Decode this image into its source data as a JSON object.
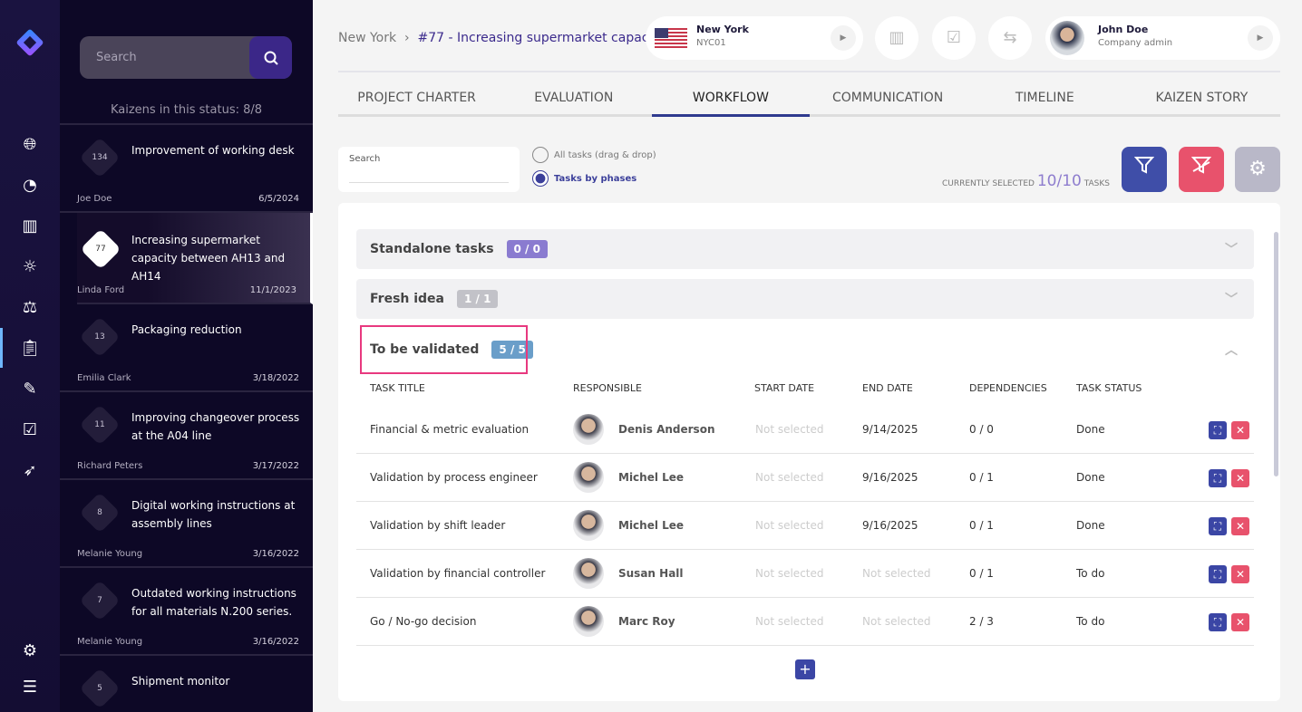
{
  "list": {
    "search_placeholder": "Search",
    "count": "Kaizens in this status: 8/8",
    "items": [
      {
        "num": "134",
        "title": "Improvement of working desk",
        "who": "Joe Doe",
        "date": "6/5/2024"
      },
      {
        "num": "77",
        "title": "Increasing supermarket capacity between AH13 and AH14",
        "who": "Linda Ford",
        "date": "11/1/2023"
      },
      {
        "num": "13",
        "title": "Packaging reduction",
        "who": "Emilia Clark",
        "date": "3/18/2022"
      },
      {
        "num": "11",
        "title": "Improving changeover process at the A04 line",
        "who": "Richard Peters",
        "date": "3/17/2022"
      },
      {
        "num": "8",
        "title": "Digital working instructions at assembly lines",
        "who": "Melanie Young",
        "date": "3/16/2022"
      },
      {
        "num": "7",
        "title": "Outdated working instructions for all materials N.200 series.",
        "who": "Melanie Young",
        "date": "3/16/2022"
      },
      {
        "num": "5",
        "title": "Shipment monitor",
        "who": "",
        "date": ""
      }
    ]
  },
  "header": {
    "crumb_root": "New York",
    "crumb_current": "#77 - Increasing supermarket capac...",
    "location": "New York",
    "location_code": "NYC01",
    "user": "John Doe",
    "role": "Company admin"
  },
  "tabs": [
    "PROJECT CHARTER",
    "EVALUATION",
    "WORKFLOW",
    "COMMUNICATION",
    "TIMELINE",
    "KAIZEN STORY"
  ],
  "toolbar": {
    "search_label": "Search",
    "radio1": "All tasks (drag & drop)",
    "radio2": "Tasks by phases",
    "selected_prefix": "CURRENTLY SELECTED",
    "selected": "10/10",
    "selected_suffix": "TASKS"
  },
  "phases": [
    {
      "name": "Standalone tasks",
      "badge": "0 / 0",
      "color": "#8a7bd0"
    },
    {
      "name": "Fresh idea",
      "badge": "1 / 1",
      "color": "#c2c2c8"
    },
    {
      "name": "To be validated",
      "badge": "5 / 5",
      "color": "#6a9ec9"
    }
  ],
  "columns": [
    "TASK TITLE",
    "RESPONSIBLE",
    "START DATE",
    "END DATE",
    "DEPENDENCIES",
    "TASK STATUS"
  ],
  "rows": [
    {
      "title": "Financial & metric evaluation",
      "resp": "Denis Anderson",
      "start": "Not selected",
      "end": "9/14/2025",
      "dep": "0 / 0",
      "status": "Done"
    },
    {
      "title": "Validation by process engineer",
      "resp": "Michel Lee",
      "start": "Not selected",
      "end": "9/16/2025",
      "dep": "0 / 1",
      "status": "Done"
    },
    {
      "title": "Validation by shift leader",
      "resp": "Michel Lee",
      "start": "Not selected",
      "end": "9/16/2025",
      "dep": "0 / 1",
      "status": "Done"
    },
    {
      "title": "Validation by financial controller",
      "resp": "Susan Hall",
      "start": "Not selected",
      "end": "Not selected",
      "dep": "0 / 1",
      "status": "To do"
    },
    {
      "title": "Go / No-go decision",
      "resp": "Marc Roy",
      "start": "Not selected",
      "end": "Not selected",
      "dep": "2 / 3",
      "status": "To do"
    }
  ]
}
